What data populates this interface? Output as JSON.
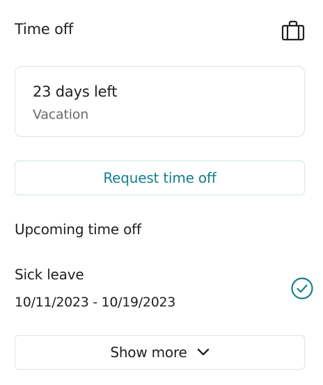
{
  "header": {
    "title": "Time off",
    "icon": "briefcase-icon"
  },
  "balance": {
    "days_left": "23 days left",
    "type": "Vacation"
  },
  "actions": {
    "request_label": "Request time off"
  },
  "upcoming": {
    "title": "Upcoming time off",
    "items": [
      {
        "name": "Sick leave",
        "dates": "10/11/2023 - 10/19/2023",
        "status_icon": "check-circle-icon"
      }
    ]
  },
  "footer": {
    "show_more_label": "Show more",
    "icon": "chevron-down-icon"
  },
  "colors": {
    "accent": "#137f8b",
    "border": "#e1e1e1",
    "muted_text": "#6b6b6b"
  }
}
